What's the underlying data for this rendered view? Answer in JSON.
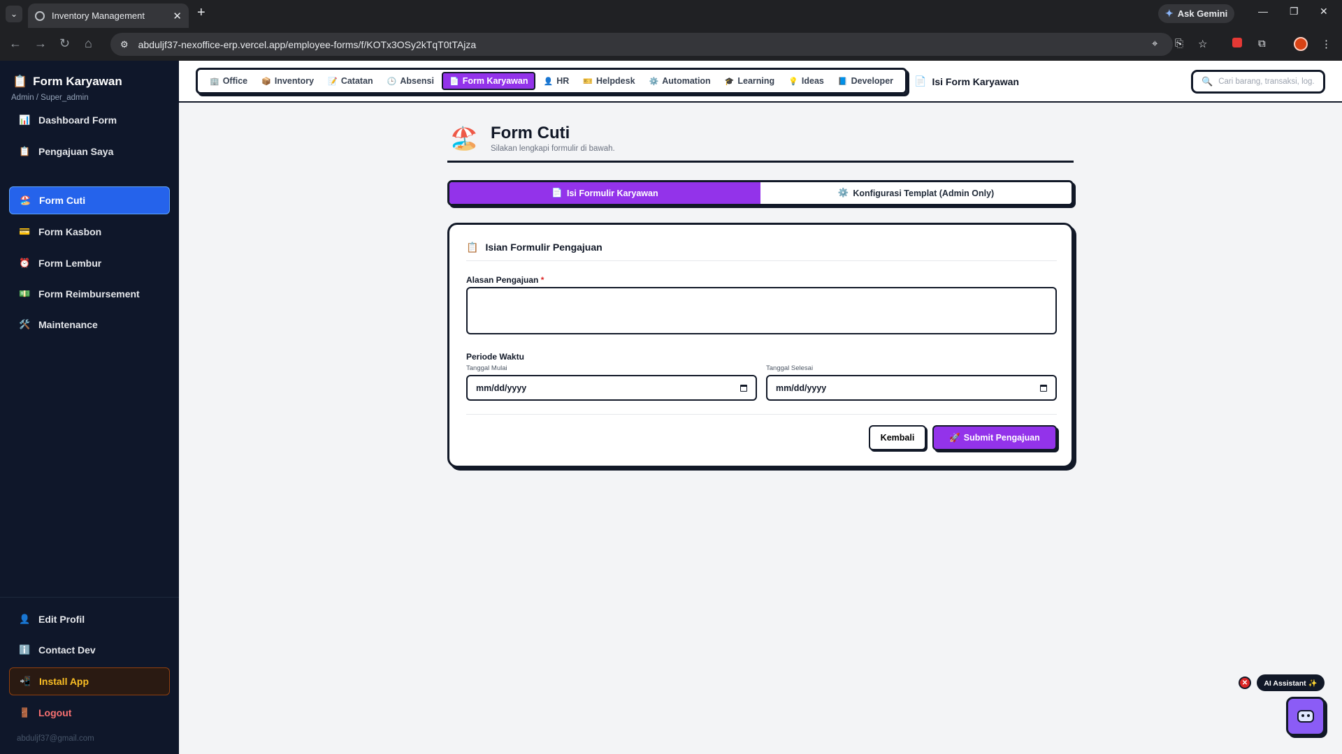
{
  "browser": {
    "tab_title": "Inventory Management",
    "url": "abduljf37-nexoffice-erp.vercel.app/employee-forms/f/KOTx3OSy2kTqT0tTAjza",
    "gemini_label": "Ask Gemini"
  },
  "sidebar": {
    "title": "Form Karyawan",
    "subtitle": "Admin / Super_admin",
    "items": [
      {
        "label": "Dashboard Form",
        "icon": "📊"
      },
      {
        "label": "Pengajuan Saya",
        "icon": "📋"
      },
      {
        "label": "Form Cuti",
        "icon": "🏖️"
      },
      {
        "label": "Form Kasbon",
        "icon": "💳"
      },
      {
        "label": "Form Lembur",
        "icon": "⏰"
      },
      {
        "label": "Form Reimbursement",
        "icon": "💵"
      },
      {
        "label": "Maintenance",
        "icon": "🛠️"
      }
    ],
    "bottom": {
      "edit_profile": "Edit Profil",
      "contact_dev": "Contact Dev",
      "install_app": "Install App",
      "logout": "Logout",
      "email": "abduljf37@gmail.com"
    }
  },
  "topnav": {
    "tabs": [
      {
        "label": "Office",
        "icon": "🏢"
      },
      {
        "label": "Inventory",
        "icon": "📦"
      },
      {
        "label": "Catatan",
        "icon": "📝"
      },
      {
        "label": "Absensi",
        "icon": "🕒"
      },
      {
        "label": "Form Karyawan",
        "icon": "📄"
      },
      {
        "label": "HR",
        "icon": "👤"
      },
      {
        "label": "Helpdesk",
        "icon": "🎫"
      },
      {
        "label": "Automation",
        "icon": "⚙️"
      },
      {
        "label": "Learning",
        "icon": "🎓"
      },
      {
        "label": "Ideas",
        "icon": "💡"
      },
      {
        "label": "Developer",
        "icon": "📘"
      }
    ],
    "active_tab": "Form Karyawan",
    "breadcrumb": "Isi Form Karyawan",
    "search_placeholder": "Cari barang, transaksi, log..."
  },
  "page": {
    "icon": "🏖️",
    "title": "Form Cuti",
    "subtitle": "Silakan lengkapi formulir di bawah.",
    "tabs": {
      "fill": "Isi Formulir Karyawan",
      "config": "Konfigurasi Templat (Admin Only)"
    },
    "card": {
      "heading": "Isian Formulir Pengajuan",
      "reason_label": "Alasan Pengajuan",
      "required_mark": "*",
      "reason_value": "",
      "period_label": "Periode Waktu",
      "start_label": "Tanggal Mulai",
      "start_value": "mm/dd/yyyy",
      "end_label": "Tanggal Selesai",
      "end_value": "mm/dd/yyyy",
      "back_button": "Kembali",
      "submit_button": "Submit Pengajuan"
    }
  },
  "assistant": {
    "label": "AI Assistant ✨",
    "close_glyph": "✕"
  },
  "colors": {
    "accent": "#9333ea",
    "sidebar_bg": "#0f172a",
    "sidebar_active": "#2563eb"
  }
}
